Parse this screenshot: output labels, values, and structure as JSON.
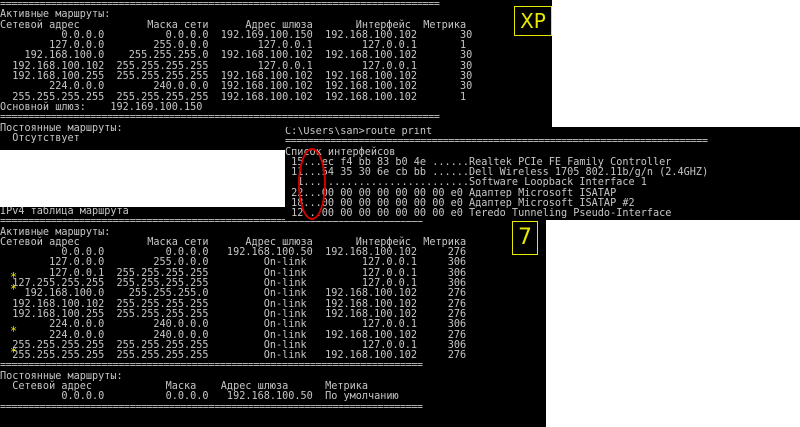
{
  "xp_window": {
    "lines": [
      "==============================================================================",
      "Активные маршруты:",
      "Сетевой адрес           Маска сети      Адрес шлюза       Интерфейс  Метрика",
      "          0.0.0.0          0.0.0.0  192.169.100.150  192.168.100.102       30",
      "        127.0.0.0        255.0.0.0        127.0.0.1        127.0.0.1       1",
      "    192.168.100.0    255.255.255.0  192.168.100.102  192.168.100.102       30",
      "  192.168.100.102  255.255.255.255        127.0.0.1        127.0.0.1       30",
      "  192.168.100.255  255.255.255.255  192.168.100.102  192.168.100.102       30",
      "        224.0.0.0        240.0.0.0  192.168.100.102  192.168.100.102       30",
      "  255.255.255.255  255.255.255.255  192.168.100.102  192.168.100.102       1",
      "Основной шлюз:    192.169.100.150",
      "==============================================================================",
      "Постоянные маршруты:",
      "  Отсутствует"
    ],
    "tag": "XP"
  },
  "route_window": {
    "lines": [
      "C:\\Users\\san>route print",
      "===========================================================================",
      "Список интерфейсов",
      " 15...ec f4 bb 83 b0 4e ......Realtek PCIe FE Family Controller",
      " 11...54 35 30 6e cb bb ......Dell Wireless 1705 802.11b/g/n (2.4GHZ)",
      "  1...........................Software Loopback Interface 1",
      " 22...00 00 00 00 00 00 00 e0 Адаптер Microsoft ISATAP",
      " 18...00 00 00 00 00 00 00 e0 Адаптер Microsoft ISATAP #2",
      " 12...00 00 00 00 00 00 00 e0 Teredo Tunneling Pseudo-Interface"
    ]
  },
  "win7_window": {
    "lines": [
      "IPv4 таблица маршрута",
      "===========================================================================",
      "Активные маршруты:",
      "Сетевой адрес           Маска сети      Адрес шлюза       Интерфейс  Метрика",
      "          0.0.0.0          0.0.0.0   192.168.100.50  192.168.100.102     276",
      "        127.0.0.0        255.0.0.0         On-link         127.0.0.1     306",
      "        127.0.0.1  255.255.255.255         On-link         127.0.0.1     306",
      "  127.255.255.255  255.255.255.255         On-link         127.0.0.1     306",
      "    192.168.100.0    255.255.255.0         On-link   192.168.100.102     276",
      "  192.168.100.102  255.255.255.255         On-link   192.168.100.102     276",
      "  192.168.100.255  255.255.255.255         On-link   192.168.100.102     276",
      "        224.0.0.0        240.0.0.0         On-link         127.0.0.1     306",
      "        224.0.0.0        240.0.0.0         On-link   192.168.100.102     276",
      "  255.255.255.255  255.255.255.255         On-link         127.0.0.1     306",
      "  255.255.255.255  255.255.255.255         On-link   192.168.100.102     276",
      "===========================================================================",
      "Постоянные маршруты:",
      "  Сетевой адрес            Маска    Адрес шлюза      Метрика",
      "          0.0.0.0          0.0.0.0   192.168.100.50  По умолчанию",
      "==========================================================================="
    ],
    "tag": "7"
  },
  "annotations": {
    "star_symbol": "*",
    "highlight_color": "#e8e800",
    "oval_color": "#d40000"
  }
}
